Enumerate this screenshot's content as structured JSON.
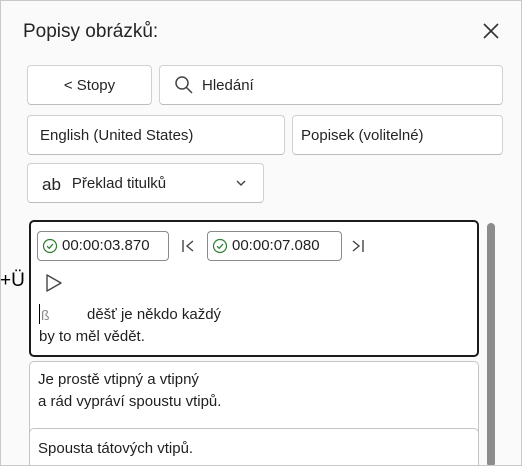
{
  "header": {
    "title": "Popisy obrázků:"
  },
  "toolbar": {
    "back_label": "< Stopy",
    "search_placeholder": "Hledání",
    "language": "English (United States)",
    "caption_label": "Popisek (volitelné)",
    "translate_prefix": "ab",
    "translate_label": "Překlad titulků"
  },
  "cues": [
    {
      "start": "00:00:03.870",
      "end": "00:00:07.080",
      "lines": [
        "děšť je někdo každý",
        "by to měl vědět."
      ],
      "cursor_char": "ß"
    },
    {
      "lines": [
        "Je prostě vtipný a vtipný",
        "a rád vypráví spoustu vtipů."
      ]
    },
    {
      "lines": [
        "Spousta tátových vtipů."
      ]
    }
  ],
  "overlay": {
    "marker": "+Ü"
  }
}
